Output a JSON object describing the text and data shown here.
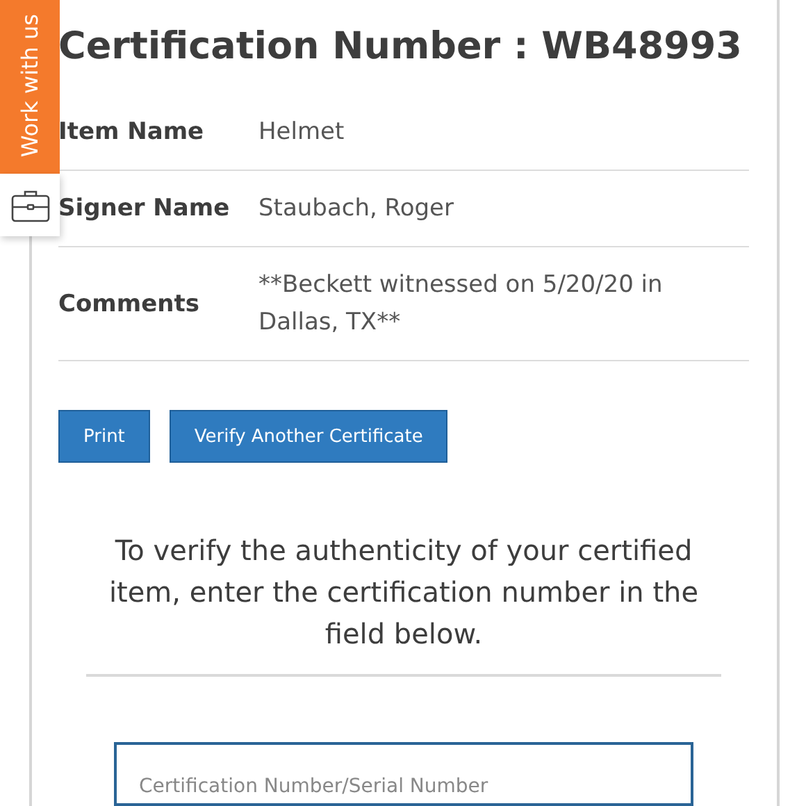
{
  "side_tab": {
    "label": "Work with us"
  },
  "title": "Certification Number : WB48993",
  "details": [
    {
      "label": "Item Name",
      "value": "Helmet"
    },
    {
      "label": "Signer Name",
      "value": "Staubach, Roger"
    },
    {
      "label": "Comments",
      "value": "**Beckett witnessed on 5/20/20 in Dallas, TX**"
    }
  ],
  "buttons": [
    {
      "label": "Print"
    },
    {
      "label": "Verify Another Certificate"
    }
  ],
  "instructions": "To verify the authenticity of your certified item, enter the certification number in the field below.",
  "search": {
    "placeholder": "Certification Number/Serial Number"
  }
}
